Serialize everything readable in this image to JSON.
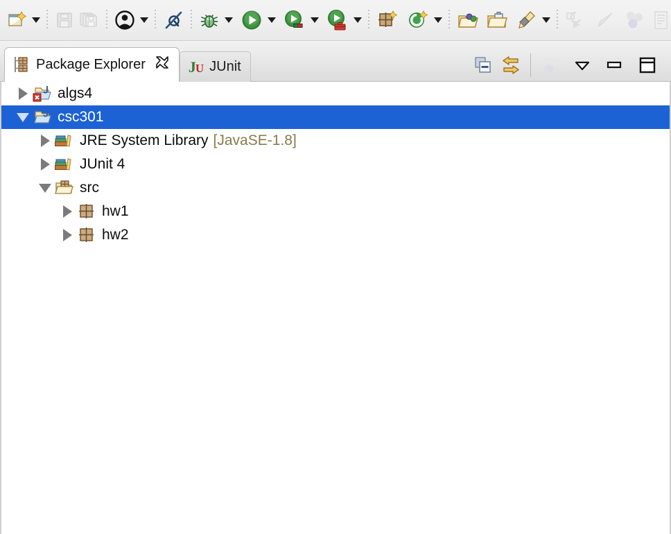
{
  "toolbar": {
    "items": [
      {
        "name": "new-wizard-button",
        "icon": "new-window-sparkle-icon",
        "label": "New",
        "enabled": true,
        "dropdown": true
      },
      {
        "name": "save-button",
        "icon": "floppy-disk-icon",
        "label": "Save",
        "enabled": false,
        "dropdown": false
      },
      {
        "name": "save-all-button",
        "icon": "floppy-disk-stack-icon",
        "label": "Save All",
        "enabled": false,
        "dropdown": false
      },
      {
        "name": "user-profile-button",
        "icon": "person-circle-icon",
        "label": "User",
        "enabled": true,
        "dropdown": true
      },
      {
        "name": "skip-all-breakpoints-button",
        "icon": "crossed-breakpoint-icon",
        "label": "Skip All Breakpoints",
        "enabled": true,
        "dropdown": false
      },
      {
        "name": "debug-button",
        "icon": "bug-icon",
        "label": "Debug",
        "enabled": true,
        "dropdown": true
      },
      {
        "name": "run-button",
        "icon": "green-play-icon",
        "label": "Run",
        "enabled": true,
        "dropdown": true
      },
      {
        "name": "coverage-button",
        "icon": "play-coverage-icon",
        "label": "Coverage",
        "enabled": true,
        "dropdown": true
      },
      {
        "name": "profile-button",
        "icon": "play-toolbox-icon",
        "label": "Profile",
        "enabled": true,
        "dropdown": true
      },
      {
        "name": "new-java-package-button",
        "icon": "package-sparkle-icon",
        "label": "New Java Package",
        "enabled": true,
        "dropdown": false
      },
      {
        "name": "new-class-button",
        "icon": "class-sparkle-icon",
        "label": "New Java Class",
        "enabled": true,
        "dropdown": true
      },
      {
        "name": "open-type-button",
        "icon": "folder-spheres-icon",
        "label": "Open Type",
        "enabled": true,
        "dropdown": false
      },
      {
        "name": "open-task-button",
        "icon": "folder-task-icon",
        "label": "Open Task",
        "enabled": true,
        "dropdown": false
      },
      {
        "name": "search-button",
        "icon": "pencil-search-icon",
        "label": "Search",
        "enabled": true,
        "dropdown": true
      },
      {
        "name": "last-edit-location-button",
        "icon": "last-edit-location-icon",
        "label": "Last Edit Location",
        "enabled": false,
        "dropdown": false
      },
      {
        "name": "back-button",
        "icon": "back-arrow-icon",
        "label": "Back",
        "enabled": false,
        "dropdown": false
      },
      {
        "name": "open-perspective-button",
        "icon": "spheres-icon",
        "label": "Open Perspective",
        "enabled": false,
        "dropdown": false
      },
      {
        "name": "show-view-button",
        "icon": "document-view-icon",
        "label": "Show View",
        "enabled": false,
        "dropdown": false
      }
    ]
  },
  "view": {
    "tabs": [
      {
        "name": "tab-package-explorer",
        "label": "Package Explorer",
        "icon": "package-explorer-icon",
        "active": true,
        "closable": true
      },
      {
        "name": "tab-junit",
        "label": "JUnit",
        "icon": "junit-icon",
        "active": false,
        "closable": false
      }
    ],
    "tools": [
      {
        "name": "collapse-all-button",
        "icon": "collapse-all-icon",
        "label": "Collapse All",
        "enabled": true
      },
      {
        "name": "link-with-editor-button",
        "icon": "link-with-editor-icon",
        "label": "Link with Editor",
        "enabled": true
      },
      {
        "name": "focus-on-active-task-button",
        "icon": "spheres-icon",
        "label": "Focus on Active Task",
        "enabled": false
      },
      {
        "name": "view-menu-button",
        "icon": "view-menu-triangle-icon",
        "label": "View Menu",
        "enabled": true
      },
      {
        "name": "minimize-button",
        "icon": "minimize-icon",
        "label": "Minimize",
        "enabled": true
      },
      {
        "name": "maximize-button",
        "icon": "maximize-icon",
        "label": "Maximize",
        "enabled": true
      }
    ]
  },
  "tree": {
    "rows": [
      {
        "name": "tree-item-algs4",
        "label": "algs4",
        "suffix": "",
        "indent": 0,
        "expander": "collapsed",
        "icon": "java-project-error-icon",
        "selected": false
      },
      {
        "name": "tree-item-csc301",
        "label": "csc301",
        "suffix": "",
        "indent": 0,
        "expander": "expanded",
        "icon": "java-project-icon",
        "selected": true
      },
      {
        "name": "tree-item-jre-system-library",
        "label": "JRE System Library",
        "suffix": "[JavaSE-1.8]",
        "indent": 1,
        "expander": "collapsed",
        "icon": "library-icon",
        "selected": false
      },
      {
        "name": "tree-item-junit-4",
        "label": "JUnit 4",
        "suffix": "",
        "indent": 1,
        "expander": "collapsed",
        "icon": "library-icon",
        "selected": false
      },
      {
        "name": "tree-item-src",
        "label": "src",
        "suffix": "",
        "indent": 1,
        "expander": "expanded",
        "icon": "source-folder-icon",
        "selected": false
      },
      {
        "name": "tree-item-hw1",
        "label": "hw1",
        "suffix": "",
        "indent": 2,
        "expander": "collapsed",
        "icon": "package-icon",
        "selected": false
      },
      {
        "name": "tree-item-hw2",
        "label": "hw2",
        "suffix": "",
        "indent": 2,
        "expander": "collapsed",
        "icon": "package-icon",
        "selected": false
      }
    ]
  },
  "colors": {
    "selection_blue": "#1c62d4",
    "dim_label": "#8a7a4a",
    "toolbar_bg": "#efefef",
    "tree_bg": "#ffffff"
  }
}
